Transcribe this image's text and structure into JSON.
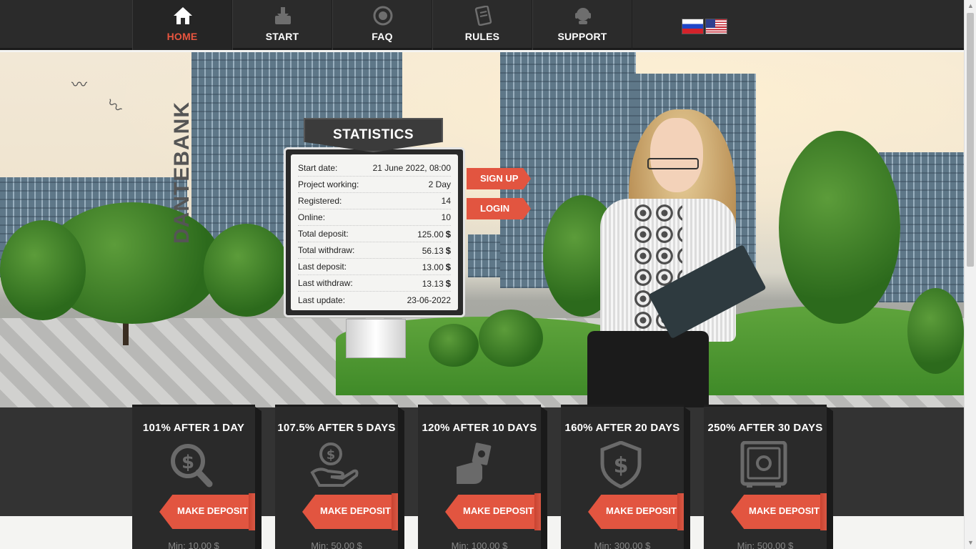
{
  "nav": {
    "items": [
      {
        "label": "HOME",
        "icon": "home-icon"
      },
      {
        "label": "START",
        "icon": "download-icon"
      },
      {
        "label": "FAQ",
        "icon": "question-icon"
      },
      {
        "label": "RULES",
        "icon": "document-icon"
      },
      {
        "label": "SUPPORT",
        "icon": "headset-icon"
      }
    ],
    "active_color": "#e8553f",
    "languages": [
      "ru-flag-icon",
      "us-flag-icon"
    ]
  },
  "hero": {
    "brand": "DANTEBANK",
    "statistics": {
      "title": "STATISTICS",
      "rows": [
        {
          "label": "Start date:",
          "value": "21 June 2022, 08:00"
        },
        {
          "label": "Project working:",
          "value": "2 Day"
        },
        {
          "label": "Registered:",
          "value": "14"
        },
        {
          "label": "Online:",
          "value": "10"
        },
        {
          "label": "Total deposit:",
          "value": "125.00",
          "currency": "$"
        },
        {
          "label": "Total withdraw:",
          "value": "56.13",
          "currency": "$"
        },
        {
          "label": "Last deposit:",
          "value": "13.00",
          "currency": "$"
        },
        {
          "label": "Last withdraw:",
          "value": "13.13",
          "currency": "$"
        },
        {
          "label": "Last update:",
          "value": "23-06-2022"
        }
      ]
    },
    "signup_label": "SIGN UP",
    "login_label": "LOGIN",
    "accent": "#e25540"
  },
  "plans": [
    {
      "title": "101% AFTER 1 DAY",
      "icon": "money-search-icon",
      "button": "MAKE DEPOSIT",
      "min": "Min: 10.00 $"
    },
    {
      "title": "107.5% AFTER 5 DAYS",
      "icon": "coin-hand-icon",
      "button": "MAKE DEPOSIT",
      "min": "Min: 50.00 $"
    },
    {
      "title": "120% AFTER 10 DAYS",
      "icon": "cash-hand-icon",
      "button": "MAKE DEPOSIT",
      "min": "Min: 100.00 $"
    },
    {
      "title": "160% AFTER 20 DAYS",
      "icon": "dollar-shield-icon",
      "button": "MAKE DEPOSIT",
      "min": "Min: 300.00 $"
    },
    {
      "title": "250% AFTER 30 DAYS",
      "icon": "safe-icon",
      "button": "MAKE DEPOSIT",
      "min": "Min: 500.00 $"
    }
  ]
}
